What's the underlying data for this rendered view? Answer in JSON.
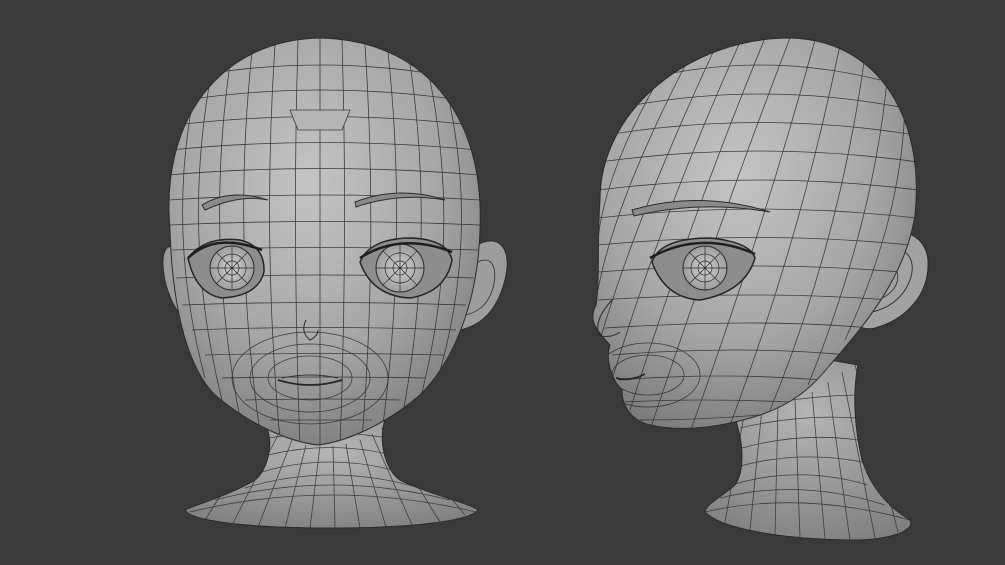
{
  "scene": {
    "background_color": "#3a3a3a",
    "mesh_color": "#a9a9a9",
    "wire_color": "#2b2b2b",
    "views": [
      {
        "id": "front",
        "label": ""
      },
      {
        "id": "three-quarter",
        "label": ""
      }
    ]
  }
}
